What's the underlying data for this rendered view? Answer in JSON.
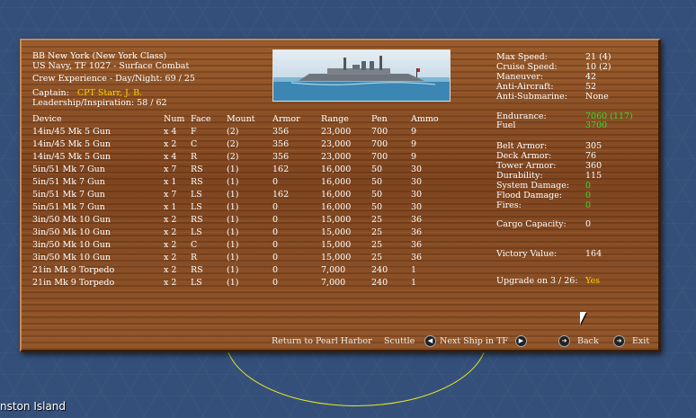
{
  "map": {
    "location_label": "nston Island"
  },
  "ship": {
    "name_line": "BB New York (New York Class)",
    "affiliation_line": "US Navy, TF 1027 - Surface Combat",
    "experience_label": "Crew Experience - Day/Night:",
    "experience_value": "69 / 25",
    "captain_label": "Captain:",
    "captain_name": "CPT Starr, J. B.",
    "leadership_label": "Leadership/Inspiration:",
    "leadership_value": "58 / 62"
  },
  "weapons": {
    "headers": [
      "Device",
      "Num",
      "Face",
      "Mount",
      "Armor",
      "Range",
      "Pen",
      "Ammo"
    ],
    "rows": [
      [
        "14in/45 Mk 5 Gun",
        "x 4",
        "F",
        "(2)",
        "356",
        "23,000",
        "700",
        "9"
      ],
      [
        "14in/45 Mk 5 Gun",
        "x 2",
        "C",
        "(2)",
        "356",
        "23,000",
        "700",
        "9"
      ],
      [
        "14in/45 Mk 5 Gun",
        "x 4",
        "R",
        "(2)",
        "356",
        "23,000",
        "700",
        "9"
      ],
      [
        "5in/51 Mk 7 Gun",
        "x 7",
        "RS",
        "(1)",
        "162",
        "16,000",
        "50",
        "30"
      ],
      [
        "5in/51 Mk 7 Gun",
        "x 1",
        "RS",
        "(1)",
        "0",
        "16,000",
        "50",
        "30"
      ],
      [
        "5in/51 Mk 7 Gun",
        "x 7",
        "LS",
        "(1)",
        "162",
        "16,000",
        "50",
        "30"
      ],
      [
        "5in/51 Mk 7 Gun",
        "x 1",
        "LS",
        "(1)",
        "0",
        "16,000",
        "50",
        "30"
      ],
      [
        "3in/50 Mk 10 Gun",
        "x 2",
        "RS",
        "(1)",
        "0",
        "15,000",
        "25",
        "36"
      ],
      [
        "3in/50 Mk 10 Gun",
        "x 2",
        "LS",
        "(1)",
        "0",
        "15,000",
        "25",
        "36"
      ],
      [
        "3in/50 Mk 10 Gun",
        "x 2",
        "C",
        "(1)",
        "0",
        "15,000",
        "25",
        "36"
      ],
      [
        "3in/50 Mk 10 Gun",
        "x 2",
        "R",
        "(1)",
        "0",
        "15,000",
        "25",
        "36"
      ],
      [
        "21in Mk 9 Torpedo",
        "x 2",
        "RS",
        "(1)",
        "0",
        "7,000",
        "240",
        "1"
      ],
      [
        "21in Mk 9 Torpedo",
        "x 2",
        "LS",
        "(1)",
        "0",
        "7,000",
        "240",
        "1"
      ]
    ]
  },
  "stats": {
    "max_speed": {
      "label": "Max Speed:",
      "value": "21 (4)"
    },
    "cruise_speed": {
      "label": "Cruise Speed:",
      "value": "10 (2)"
    },
    "maneuver": {
      "label": "Maneuver:",
      "value": "42"
    },
    "anti_aircraft": {
      "label": "Anti-Aircraft:",
      "value": "52"
    },
    "anti_submarine": {
      "label": "Anti-Submarine:",
      "value": "None"
    },
    "endurance": {
      "label": "Endurance:",
      "value": "7060 (117)"
    },
    "fuel": {
      "label": "Fuel",
      "value": "3700"
    },
    "belt_armor": {
      "label": "Belt Armor:",
      "value": "305"
    },
    "deck_armor": {
      "label": "Deck Armor:",
      "value": "76"
    },
    "tower_armor": {
      "label": "Tower Armor:",
      "value": "360"
    },
    "durability": {
      "label": "Durability:",
      "value": "115"
    },
    "system_damage": {
      "label": "System Damage:",
      "value": "0"
    },
    "flood_damage": {
      "label": "Flood Damage:",
      "value": "0"
    },
    "fires": {
      "label": "Fires:",
      "value": "0"
    },
    "cargo_capacity": {
      "label": "Cargo Capacity:",
      "value": "0"
    },
    "victory_value": {
      "label": "Victory Value:",
      "value": "164"
    },
    "upgrade": {
      "label": "Upgrade on 3 / 26:",
      "value": "Yes"
    }
  },
  "buttons": {
    "return": "Return to Pearl Harbor",
    "scuttle": "Scuttle",
    "next_ship": "Next Ship in TF",
    "back": "Back",
    "exit": "Exit"
  },
  "colors": {
    "highlight_yellow": "#ffd200",
    "highlight_green": "#2ee02e",
    "wood": "#8a4f24"
  }
}
